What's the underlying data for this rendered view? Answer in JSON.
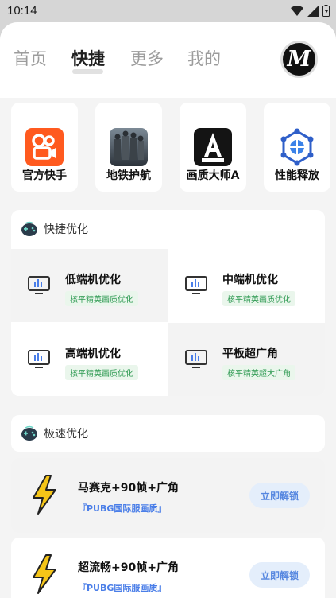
{
  "status": {
    "time": "10:14"
  },
  "nav": {
    "tabs": [
      "首页",
      "快捷",
      "更多",
      "我的"
    ],
    "active": "快捷",
    "avatar_text": "M"
  },
  "apps": [
    {
      "label": "官方快手",
      "icon": "kuaishou-icon"
    },
    {
      "label": "地铁护航",
      "icon": "metro-game-icon"
    },
    {
      "label": "画质大师A",
      "icon": "quality-master-icon"
    },
    {
      "label": "性能释放",
      "icon": "performance-icon"
    }
  ],
  "quick": {
    "title": "快捷优化",
    "options": [
      {
        "name": "低端机优化",
        "badge": "核平精英画质优化"
      },
      {
        "name": "中端机优化",
        "badge": "核平精英画质优化"
      },
      {
        "name": "高端机优化",
        "badge": "核平精英画质优化"
      },
      {
        "name": "平板超广角",
        "badge": "核平精英超大广角"
      }
    ]
  },
  "speed": {
    "title": "极速优化",
    "items": [
      {
        "name": "马赛克+90帧+广角",
        "sub": "『PUBG国际服画质』",
        "button": "立即解锁"
      },
      {
        "name": "超流畅+90帧+广角",
        "sub": "『PUBG国际服画质』",
        "button": "立即解锁"
      }
    ]
  },
  "colors": {
    "accent_blue": "#5687e0",
    "badge_green": "#2e9a52"
  }
}
